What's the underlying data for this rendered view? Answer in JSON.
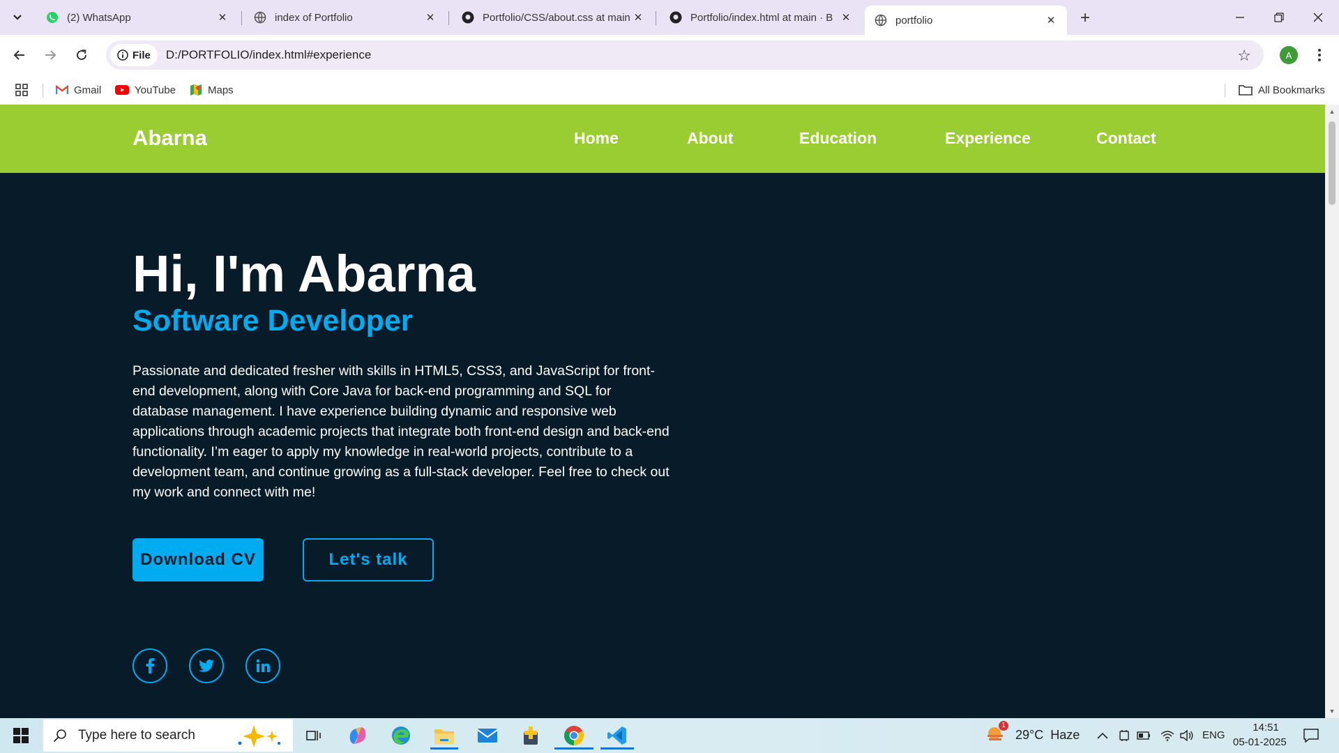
{
  "browser": {
    "tabs": [
      {
        "title": "(2) WhatsApp",
        "icon": "whatsapp-icon"
      },
      {
        "title": "index of Portfolio",
        "icon": "globe-icon"
      },
      {
        "title": "Portfolio/CSS/about.css at main",
        "icon": "github-icon"
      },
      {
        "title": "Portfolio/index.html at main · B",
        "icon": "github-icon"
      },
      {
        "title": "portfolio",
        "icon": "globe-icon",
        "active": true
      }
    ],
    "site_chip": "File",
    "url": "D:/PORTFOLIO/index.html#experience",
    "profile_initial": "A",
    "bookmarks": [
      {
        "label": "Gmail",
        "icon": "gmail-icon"
      },
      {
        "label": "YouTube",
        "icon": "youtube-icon"
      },
      {
        "label": "Maps",
        "icon": "maps-icon"
      }
    ],
    "all_bookmarks": "All Bookmarks"
  },
  "site": {
    "logo": "Abarna",
    "nav": [
      "Home",
      "About",
      "Education",
      "Experience",
      "Contact"
    ],
    "hero": {
      "title": "Hi, I'm Abarna",
      "subtitle": "Software Developer",
      "description": "Passionate and dedicated fresher with skills in HTML5, CSS3, and JavaScript for front-end development, along with Core Java for back-end programming and SQL for database management. I have experience building dynamic and responsive web applications through academic projects that integrate both front-end design and back-end functionality. I’m eager to apply my knowledge in real-world projects, contribute to a development team, and continue growing as a full-stack developer. Feel free to check out my work and connect with me!",
      "btn_cv": "Download CV",
      "btn_talk": "Let's talk"
    },
    "social": [
      "facebook-icon",
      "twitter-icon",
      "linkedin-icon"
    ]
  },
  "taskbar": {
    "search_placeholder": "Type here to search",
    "weather": "29°C  Haze",
    "weather_badge": "1",
    "language": "ENG",
    "time": "14:51",
    "date": "05-01-2025"
  },
  "colors": {
    "header_green": "#9acd32",
    "page_bg": "#081b29",
    "accent_blue": "#00abf0"
  }
}
